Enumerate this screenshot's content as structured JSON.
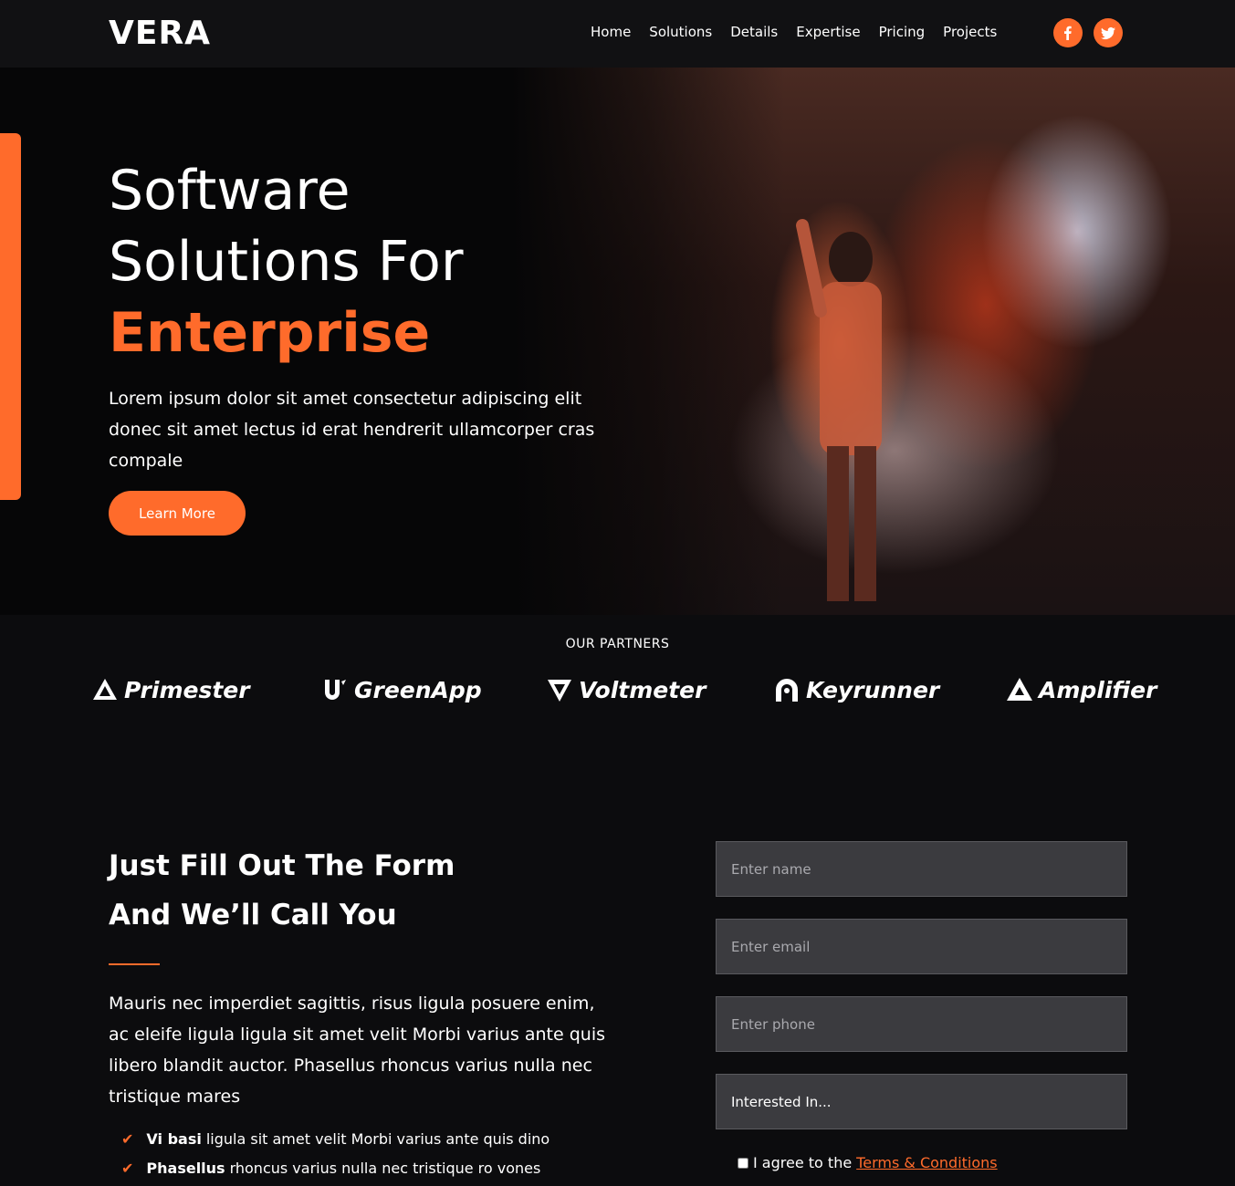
{
  "brand": {
    "logo": "VERA",
    "accent_color": "#ff6b2b"
  },
  "nav": {
    "links": [
      "Home",
      "Solutions",
      "Details",
      "Expertise",
      "Pricing",
      "Projects"
    ],
    "social": [
      "facebook-icon",
      "twitter-icon"
    ]
  },
  "hero": {
    "title_line1": "Software",
    "title_line2": "Solutions For",
    "title_accent": "Enterprise",
    "description": "Lorem ipsum dolor sit amet consectetur adipiscing elit donec sit amet lectus id erat hendrerit ullamcorper cras compale",
    "button_label": "Learn More"
  },
  "partners": {
    "heading": "OUR PARTNERS",
    "items": [
      "Primester",
      "GreenApp",
      "Voltmeter",
      "Keyrunner",
      "Amplifier"
    ]
  },
  "form_section": {
    "heading_line1": "Just Fill Out The Form",
    "heading_line2": "And We’ll Call You",
    "description": "Mauris nec imperdiet sagittis, risus ligula posuere enim, ac eleife ligula ligula sit amet velit Morbi varius ante quis libero blandit auctor. Phasellus rhoncus varius nulla nec tristique mares",
    "checklist": [
      {
        "bold": "Vi basi",
        "text": "ligula sit amet velit Morbi varius ante quis dino"
      },
      {
        "bold": "Phasellus",
        "text": "rhoncus varius nulla nec tristique ro vones"
      }
    ]
  },
  "form": {
    "name_placeholder": "Enter name",
    "email_placeholder": "Enter email",
    "phone_placeholder": "Enter phone",
    "interest_value": "Interested In...",
    "agree_text": "I agree to the",
    "terms_link": "Terms & Conditions"
  }
}
